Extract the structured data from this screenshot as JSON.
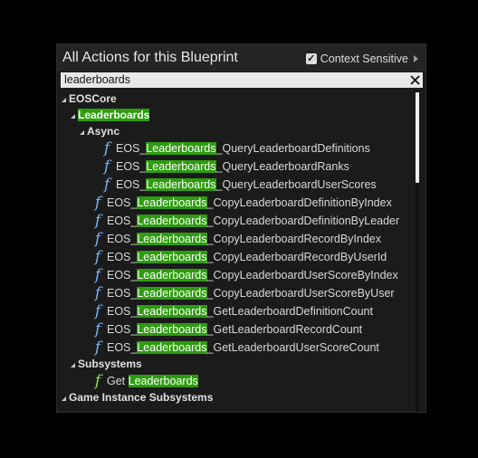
{
  "window": {
    "title": "All Actions for this Blueprint",
    "context_sensitive_label": "Context Sensitive",
    "context_sensitive_checked": true
  },
  "search": {
    "value": "leaderboards"
  },
  "tree": {
    "category_eoscore": "EOSCore",
    "category_leaderboards": "Leaderboards",
    "category_async": "Async",
    "category_subsystems": "Subsystems",
    "category_game_instance_subsystems": "Game Instance Subsystems",
    "async_items": [
      {
        "prefix": "EOS_",
        "match": "Leaderboards",
        "suffix": "_QueryLeaderboardDefinitions"
      },
      {
        "prefix": "EOS_",
        "match": "Leaderboards",
        "suffix": "_QueryLeaderboardRanks"
      },
      {
        "prefix": "EOS_",
        "match": "Leaderboards",
        "suffix": "_QueryLeaderboardUserScores"
      }
    ],
    "leaderboard_items": [
      {
        "prefix": "EOS_",
        "match": "Leaderboards",
        "suffix": "_CopyLeaderboardDefinitionByIndex"
      },
      {
        "prefix": "EOS_",
        "match": "Leaderboards",
        "suffix": "_CopyLeaderboardDefinitionByLeader"
      },
      {
        "prefix": "EOS_",
        "match": "Leaderboards",
        "suffix": "_CopyLeaderboardRecordByIndex"
      },
      {
        "prefix": "EOS_",
        "match": "Leaderboards",
        "suffix": "_CopyLeaderboardRecordByUserId"
      },
      {
        "prefix": "EOS_",
        "match": "Leaderboards",
        "suffix": "_CopyLeaderboardUserScoreByIndex"
      },
      {
        "prefix": "EOS_",
        "match": "Leaderboards",
        "suffix": "_CopyLeaderboardUserScoreByUser"
      },
      {
        "prefix": "EOS_",
        "match": "Leaderboards",
        "suffix": "_GetLeaderboardDefinitionCount"
      },
      {
        "prefix": "EOS_",
        "match": "Leaderboards",
        "suffix": "_GetLeaderboardRecordCount"
      },
      {
        "prefix": "EOS_",
        "match": "Leaderboards",
        "suffix": "_GetLeaderboardUserScoreCount"
      }
    ],
    "subsystem_items": [
      {
        "prefix": "Get ",
        "match": "Leaderboards",
        "suffix": ""
      }
    ],
    "function_icon_glyph": "f"
  },
  "colors": {
    "highlight": "#2e9c0f",
    "function_icon": "#76b3ec",
    "pure_function_icon": "#93dc58"
  }
}
